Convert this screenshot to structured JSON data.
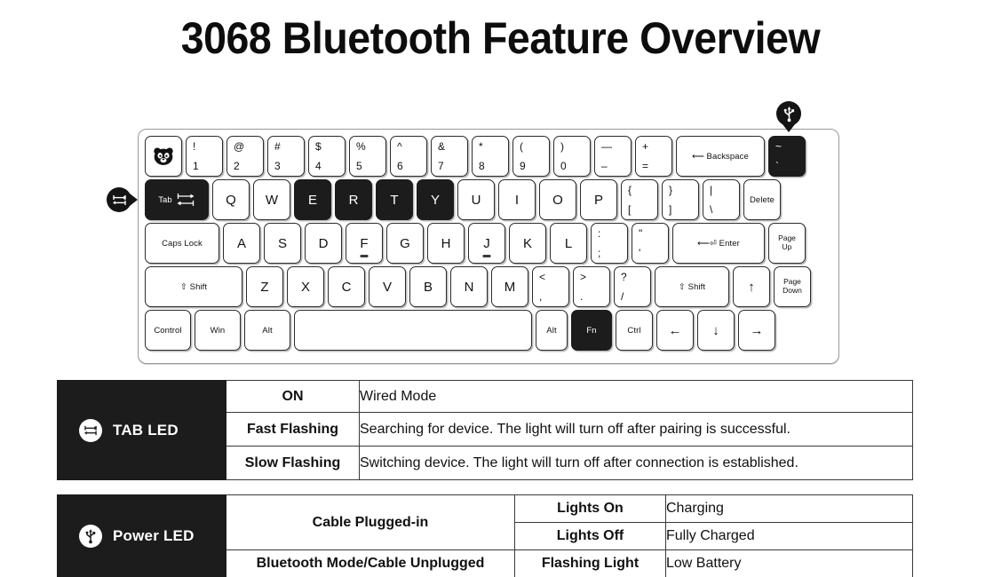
{
  "page": {
    "title": "3068 Bluetooth Feature Overview"
  },
  "callouts": {
    "tab_badge_icon": "tab-arrows-icon",
    "usb_badge_icon": "usb-icon"
  },
  "keyboard": {
    "name": "3068 keyboard diagram",
    "rows": [
      {
        "name": "number-row",
        "keys": [
          {
            "name": "escape-key",
            "type": "logo",
            "icon": "panda-logo-icon",
            "width": "w-esc",
            "dark": false
          },
          {
            "name": "key-1",
            "type": "dual",
            "top": "!",
            "bot": "1",
            "dark": false
          },
          {
            "name": "key-2",
            "type": "dual",
            "top": "@",
            "bot": "2",
            "dark": false
          },
          {
            "name": "key-3",
            "type": "dual",
            "top": "#",
            "bot": "3",
            "dark": false
          },
          {
            "name": "key-4",
            "type": "dual",
            "top": "$",
            "bot": "4",
            "dark": false
          },
          {
            "name": "key-5",
            "type": "dual",
            "top": "%",
            "bot": "5",
            "dark": false
          },
          {
            "name": "key-6",
            "type": "dual",
            "top": "^",
            "bot": "6",
            "dark": false
          },
          {
            "name": "key-7",
            "type": "dual",
            "top": "&",
            "bot": "7",
            "dark": false
          },
          {
            "name": "key-8",
            "type": "dual",
            "top": "*",
            "bot": "8",
            "dark": false
          },
          {
            "name": "key-9",
            "type": "dual",
            "top": "(",
            "bot": "9",
            "dark": false
          },
          {
            "name": "key-0",
            "type": "dual",
            "top": ")",
            "bot": "0",
            "dark": false
          },
          {
            "name": "key-minus",
            "type": "dual",
            "top": "—",
            "bot": "–",
            "dark": false
          },
          {
            "name": "key-equals",
            "type": "dual",
            "top": "+",
            "bot": "=",
            "dark": false
          },
          {
            "name": "backspace-key",
            "type": "small",
            "label": "⟵ Backspace",
            "width": "w-bksp",
            "dark": false
          },
          {
            "name": "key-backtick",
            "type": "dual",
            "top": "~",
            "bot": "`",
            "dark": true
          }
        ]
      },
      {
        "name": "qwerty-row",
        "keys": [
          {
            "name": "tab-key",
            "type": "tabkey",
            "label": "Tab",
            "width": "w-tab",
            "dark": true
          },
          {
            "name": "key-q",
            "type": "letter",
            "label": "Q",
            "dark": false
          },
          {
            "name": "key-w",
            "type": "letter",
            "label": "W",
            "dark": false
          },
          {
            "name": "key-e",
            "type": "letter",
            "label": "E",
            "dark": true
          },
          {
            "name": "key-r",
            "type": "letter",
            "label": "R",
            "dark": true
          },
          {
            "name": "key-t",
            "type": "letter",
            "label": "T",
            "dark": true
          },
          {
            "name": "key-y",
            "type": "letter",
            "label": "Y",
            "dark": true
          },
          {
            "name": "key-u",
            "type": "letter",
            "label": "U",
            "dark": false
          },
          {
            "name": "key-i",
            "type": "letter",
            "label": "I",
            "dark": false
          },
          {
            "name": "key-o",
            "type": "letter",
            "label": "O",
            "dark": false
          },
          {
            "name": "key-p",
            "type": "letter",
            "label": "P",
            "dark": false
          },
          {
            "name": "key-leftbracket",
            "type": "dual",
            "top": "{",
            "bot": "[",
            "dark": false
          },
          {
            "name": "key-rightbracket",
            "type": "dual",
            "top": "}",
            "bot": "]",
            "dark": false
          },
          {
            "name": "key-backslash",
            "type": "dual",
            "top": "|",
            "bot": "\\",
            "dark": false
          },
          {
            "name": "delete-key",
            "type": "small",
            "label": "Delete",
            "dark": false
          }
        ]
      },
      {
        "name": "home-row",
        "keys": [
          {
            "name": "capslock-key",
            "type": "small",
            "label": "Caps Lock",
            "width": "w-caps",
            "dark": false
          },
          {
            "name": "key-a",
            "type": "letter",
            "label": "A",
            "dark": false
          },
          {
            "name": "key-s",
            "type": "letter",
            "label": "S",
            "dark": false
          },
          {
            "name": "key-d",
            "type": "letter",
            "label": "D",
            "dark": false
          },
          {
            "name": "key-f",
            "type": "letter",
            "label": "F",
            "dark": false,
            "bump": true
          },
          {
            "name": "key-g",
            "type": "letter",
            "label": "G",
            "dark": false
          },
          {
            "name": "key-h",
            "type": "letter",
            "label": "H",
            "dark": false
          },
          {
            "name": "key-j",
            "type": "letter",
            "label": "J",
            "dark": false,
            "bump": true
          },
          {
            "name": "key-k",
            "type": "letter",
            "label": "K",
            "dark": false
          },
          {
            "name": "key-l",
            "type": "letter",
            "label": "L",
            "dark": false
          },
          {
            "name": "key-semicolon",
            "type": "dual",
            "top": ":",
            "bot": ";",
            "dark": false
          },
          {
            "name": "key-quote",
            "type": "dual",
            "top": "\"",
            "bot": "'",
            "dark": false
          },
          {
            "name": "enter-key",
            "type": "small",
            "label": "⟵⏎ Enter",
            "width": "w-enter",
            "dark": false
          },
          {
            "name": "pageup-key",
            "type": "tiny",
            "label": "Page\nUp",
            "dark": false
          }
        ]
      },
      {
        "name": "shift-row",
        "keys": [
          {
            "name": "left-shift-key",
            "type": "small",
            "label": "⇧ Shift",
            "width": "w-shift",
            "dark": false
          },
          {
            "name": "key-z",
            "type": "letter",
            "label": "Z",
            "dark": false
          },
          {
            "name": "key-x",
            "type": "letter",
            "label": "X",
            "dark": false
          },
          {
            "name": "key-c",
            "type": "letter",
            "label": "C",
            "dark": false
          },
          {
            "name": "key-v",
            "type": "letter",
            "label": "V",
            "dark": false
          },
          {
            "name": "key-b",
            "type": "letter",
            "label": "B",
            "dark": false
          },
          {
            "name": "key-n",
            "type": "letter",
            "label": "N",
            "dark": false
          },
          {
            "name": "key-m",
            "type": "letter",
            "label": "M",
            "dark": false
          },
          {
            "name": "key-comma",
            "type": "dual",
            "top": "<",
            "bot": ",",
            "dark": false
          },
          {
            "name": "key-period",
            "type": "dual",
            "top": ">",
            "bot": ".",
            "dark": false
          },
          {
            "name": "key-slash",
            "type": "dual",
            "top": "?",
            "bot": "/",
            "dark": false
          },
          {
            "name": "right-shift-key",
            "type": "small",
            "label": "⇧ Shift",
            "width": "w-rshift",
            "dark": false
          },
          {
            "name": "arrow-up-key",
            "type": "letter",
            "label": "↑",
            "dark": false
          },
          {
            "name": "pagedown-key",
            "type": "tiny",
            "label": "Page\nDown",
            "dark": false
          }
        ]
      },
      {
        "name": "bottom-row",
        "keys": [
          {
            "name": "control-key",
            "type": "small",
            "label": "Control",
            "width": "w-ctrl",
            "dark": false
          },
          {
            "name": "win-key",
            "type": "small",
            "label": "Win",
            "width": "w-win",
            "dark": false
          },
          {
            "name": "left-alt-key",
            "type": "small",
            "label": "Alt",
            "width": "w-alt",
            "dark": false
          },
          {
            "name": "space-key",
            "type": "blank",
            "label": "",
            "width": "w-space",
            "dark": false
          },
          {
            "name": "right-alt-key",
            "type": "small",
            "label": "Alt",
            "width": "w-altr",
            "dark": false
          },
          {
            "name": "fn-key",
            "type": "small",
            "label": "Fn",
            "width": "w-fn",
            "dark": true
          },
          {
            "name": "right-ctrl-key",
            "type": "small",
            "label": "Ctrl",
            "width": "w-ctrlr",
            "dark": false
          },
          {
            "name": "arrow-left-key",
            "type": "letter",
            "label": "←",
            "dark": false
          },
          {
            "name": "arrow-down-key",
            "type": "letter",
            "label": "↓",
            "dark": false
          },
          {
            "name": "arrow-right-key",
            "type": "letter",
            "label": "→",
            "dark": false
          }
        ]
      }
    ]
  },
  "tab_led_table": {
    "label": "TAB LED",
    "icon": "tab-arrows-icon",
    "rows": [
      {
        "state": "ON",
        "description": "Wired Mode"
      },
      {
        "state": "Fast Flashing",
        "description": "Searching for device. The light will turn off after pairing is successful."
      },
      {
        "state": "Slow Flashing",
        "description": "Switching device. The light will turn off after connection is established."
      }
    ]
  },
  "power_led_table": {
    "label": "Power LED",
    "icon": "usb-icon",
    "rows": [
      {
        "mode": "Cable Plugged-in",
        "state": "Lights On",
        "description": "Charging"
      },
      {
        "mode": "",
        "state": "Lights Off",
        "description": "Fully Charged"
      },
      {
        "mode": "Bluetooth Mode/Cable Unplugged",
        "state": "Flashing Light",
        "description": "Low Battery"
      }
    ]
  },
  "colors": {
    "ink": "#111111",
    "dark_panel": "#1c1c1c",
    "key_border": "#2b2b2b",
    "case_border": "#9a9a9a",
    "page_bg": "#ffffff"
  }
}
